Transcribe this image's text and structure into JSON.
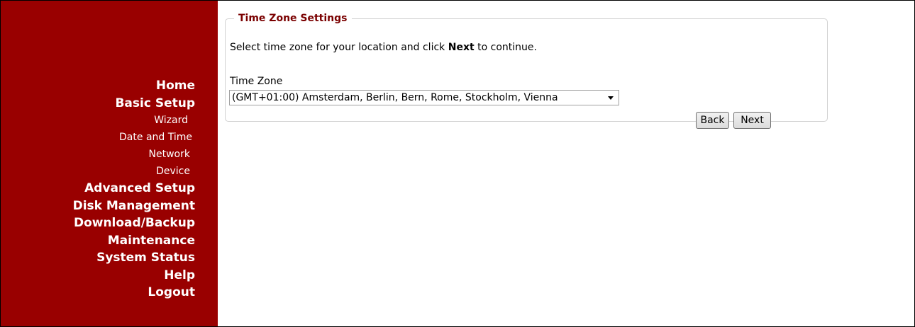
{
  "sidebar": {
    "items": [
      {
        "label": "Home",
        "type": "main"
      },
      {
        "label": "Basic Setup",
        "type": "main"
      },
      {
        "label": "Wizard",
        "type": "sub"
      },
      {
        "label": "Date and Time",
        "type": "sub"
      },
      {
        "label": "Network",
        "type": "sub"
      },
      {
        "label": "Device",
        "type": "sub"
      },
      {
        "label": "Advanced Setup",
        "type": "main"
      },
      {
        "label": "Disk Management",
        "type": "main"
      },
      {
        "label": "Download/Backup",
        "type": "main"
      },
      {
        "label": "Maintenance",
        "type": "main"
      },
      {
        "label": "System Status",
        "type": "main"
      },
      {
        "label": "Help",
        "type": "main"
      },
      {
        "label": "Logout",
        "type": "main"
      }
    ]
  },
  "panel": {
    "legend": "Time Zone Settings",
    "instruction_prefix": "Select time zone for your location and click ",
    "instruction_bold": "Next",
    "instruction_suffix": " to continue.",
    "timezone_label": "Time Zone",
    "timezone_value": "(GMT+01:00) Amsterdam, Berlin, Bern, Rome, Stockholm, Vienna",
    "back_label": "Back",
    "next_label": "Next"
  },
  "colors": {
    "sidebar_bg": "#990000",
    "legend_text": "#7a0000"
  }
}
